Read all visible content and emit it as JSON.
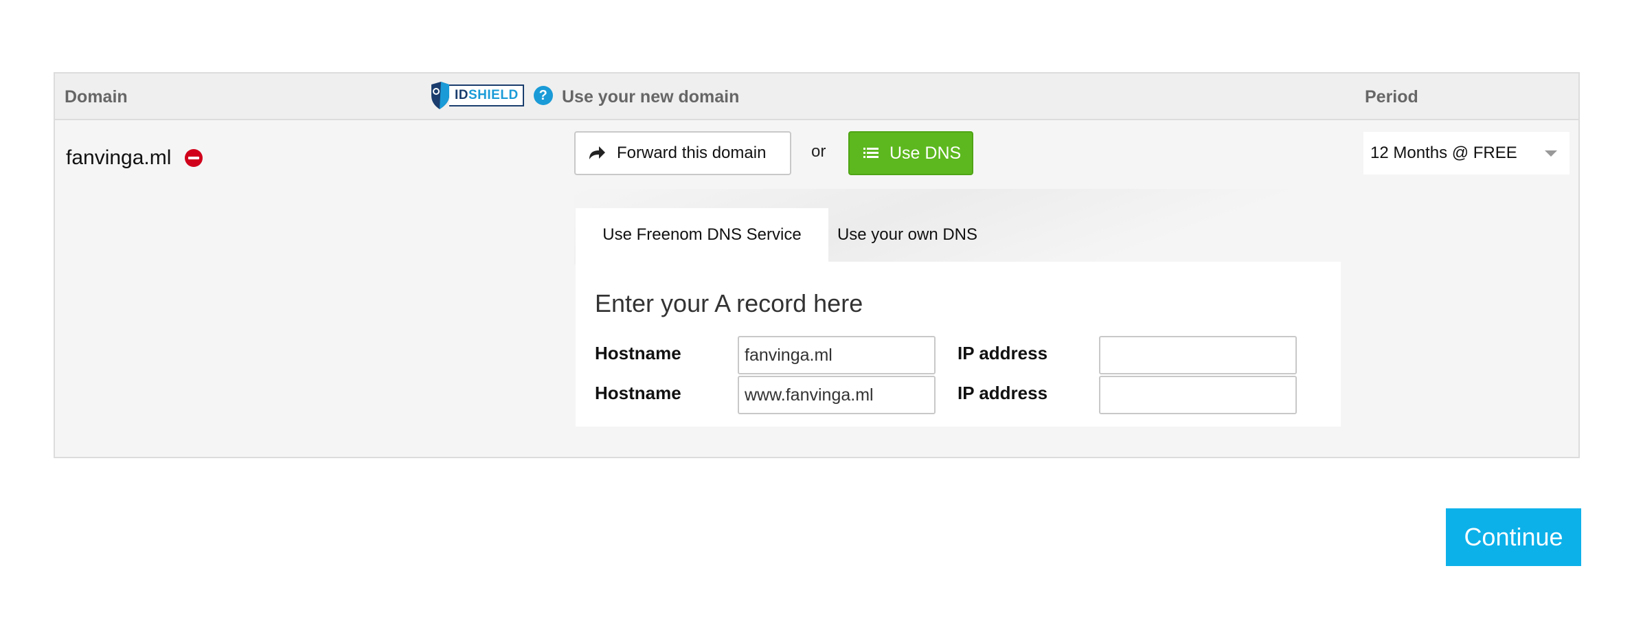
{
  "table": {
    "headers": {
      "domain": "Domain",
      "use_domain": "Use your new domain",
      "period": "Period"
    },
    "idshield": {
      "id_text": "ID",
      "shield_text": "SHIELD",
      "help": "?"
    }
  },
  "row": {
    "domain_name": "fanvinga.ml",
    "forward_button": "Forward this domain",
    "or_text": "or",
    "dns_button": "Use DNS",
    "period_selected": "12 Months @ FREE"
  },
  "dns": {
    "tabs": [
      "Use Freenom DNS Service",
      "Use your own DNS"
    ],
    "record_title": "Enter your A record here",
    "hostname_label": "Hostname",
    "ip_label": "IP address",
    "rows": [
      {
        "hostname": "fanvinga.ml",
        "ip": ""
      },
      {
        "hostname": "www.fanvinga.ml",
        "ip": ""
      }
    ]
  },
  "continue_button": "Continue",
  "colors": {
    "accent_blue": "#0db1ea",
    "dns_green": "#5db81f",
    "remove_red": "#d0021b",
    "idshield_navy": "#1a3d6d"
  },
  "icons": [
    "idshield-logo-icon",
    "help-icon",
    "remove-icon",
    "forward-arrow-icon",
    "list-icon",
    "chevron-down-icon"
  ]
}
